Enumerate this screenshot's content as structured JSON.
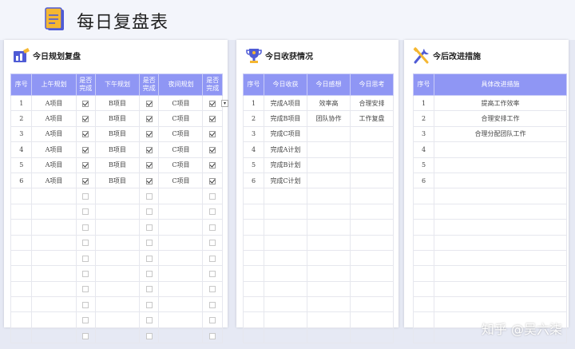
{
  "page": {
    "title": "每日复盘表",
    "watermark": "知乎 @吴六柒"
  },
  "plan": {
    "title": "今日规划复盘",
    "headers": [
      "序号",
      "上午规划",
      "是否\n完成",
      "下午规划",
      "是否\n完成",
      "夜间规划",
      "是否\n完成"
    ],
    "rows": [
      {
        "no": "1",
        "am": "A项目",
        "am_done": true,
        "pm": "B项目",
        "pm_done": true,
        "night": "C项目",
        "night_done": true
      },
      {
        "no": "2",
        "am": "A项目",
        "am_done": true,
        "pm": "B项目",
        "pm_done": true,
        "night": "C项目",
        "night_done": true
      },
      {
        "no": "3",
        "am": "A项目",
        "am_done": true,
        "pm": "B项目",
        "pm_done": true,
        "night": "C项目",
        "night_done": true
      },
      {
        "no": "4",
        "am": "A项目",
        "am_done": true,
        "pm": "B项目",
        "pm_done": true,
        "night": "C项目",
        "night_done": true
      },
      {
        "no": "5",
        "am": "A项目",
        "am_done": true,
        "pm": "B项目",
        "pm_done": true,
        "night": "C项目",
        "night_done": true
      },
      {
        "no": "6",
        "am": "A项目",
        "am_done": true,
        "pm": "B项目",
        "pm_done": true,
        "night": "C项目",
        "night_done": true
      },
      {
        "no": "",
        "am": "",
        "am_done": false,
        "pm": "",
        "pm_done": false,
        "night": "",
        "night_done": false
      },
      {
        "no": "",
        "am": "",
        "am_done": false,
        "pm": "",
        "pm_done": false,
        "night": "",
        "night_done": false
      },
      {
        "no": "",
        "am": "",
        "am_done": false,
        "pm": "",
        "pm_done": false,
        "night": "",
        "night_done": false
      },
      {
        "no": "",
        "am": "",
        "am_done": false,
        "pm": "",
        "pm_done": false,
        "night": "",
        "night_done": false
      },
      {
        "no": "",
        "am": "",
        "am_done": false,
        "pm": "",
        "pm_done": false,
        "night": "",
        "night_done": false
      },
      {
        "no": "",
        "am": "",
        "am_done": false,
        "pm": "",
        "pm_done": false,
        "night": "",
        "night_done": false
      },
      {
        "no": "",
        "am": "",
        "am_done": false,
        "pm": "",
        "pm_done": false,
        "night": "",
        "night_done": false
      },
      {
        "no": "",
        "am": "",
        "am_done": false,
        "pm": "",
        "pm_done": false,
        "night": "",
        "night_done": false
      },
      {
        "no": "",
        "am": "",
        "am_done": false,
        "pm": "",
        "pm_done": false,
        "night": "",
        "night_done": false
      },
      {
        "no": "",
        "am": "",
        "am_done": false,
        "pm": "",
        "pm_done": false,
        "night": "",
        "night_done": false
      }
    ]
  },
  "harvest": {
    "title": "今日收获情况",
    "headers": [
      "序号",
      "今日收获",
      "今日感想",
      "今日思考"
    ],
    "rows": [
      [
        "1",
        "完成A项目",
        "效率高",
        "合理安排"
      ],
      [
        "2",
        "完成B项目",
        "团队协作",
        "工作复盘"
      ],
      [
        "3",
        "完成C项目",
        "",
        ""
      ],
      [
        "4",
        "完成A计划",
        "",
        ""
      ],
      [
        "5",
        "完成B计划",
        "",
        ""
      ],
      [
        "6",
        "完成C计划",
        "",
        ""
      ],
      [
        "",
        "",
        "",
        ""
      ],
      [
        "",
        "",
        "",
        ""
      ],
      [
        "",
        "",
        "",
        ""
      ],
      [
        "",
        "",
        "",
        ""
      ],
      [
        "",
        "",
        "",
        ""
      ],
      [
        "",
        "",
        "",
        ""
      ],
      [
        "",
        "",
        "",
        ""
      ],
      [
        "",
        "",
        "",
        ""
      ],
      [
        "",
        "",
        "",
        ""
      ],
      [
        "",
        "",
        "",
        ""
      ]
    ]
  },
  "improve": {
    "title": "今后改进措施",
    "headers": [
      "序号",
      "具体改进措施"
    ],
    "rows": [
      [
        "1",
        "提高工作效率"
      ],
      [
        "2",
        "合理安排工作"
      ],
      [
        "3",
        "合理分配团队工作"
      ],
      [
        "4",
        ""
      ],
      [
        "5",
        ""
      ],
      [
        "6",
        ""
      ],
      [
        "",
        ""
      ],
      [
        "",
        ""
      ],
      [
        "",
        ""
      ],
      [
        "",
        ""
      ],
      [
        "",
        ""
      ],
      [
        "",
        ""
      ],
      [
        "",
        ""
      ],
      [
        "",
        ""
      ],
      [
        "",
        ""
      ],
      [
        "",
        ""
      ]
    ]
  },
  "colors": {
    "header": "#8f96f4",
    "accent_icon": "#f5b731"
  },
  "icons": {
    "title": "document-icon",
    "plan": "chart-icon",
    "harvest": "trophy-icon",
    "improve": "tools-icon",
    "dropdown": "chevron-down-icon"
  }
}
